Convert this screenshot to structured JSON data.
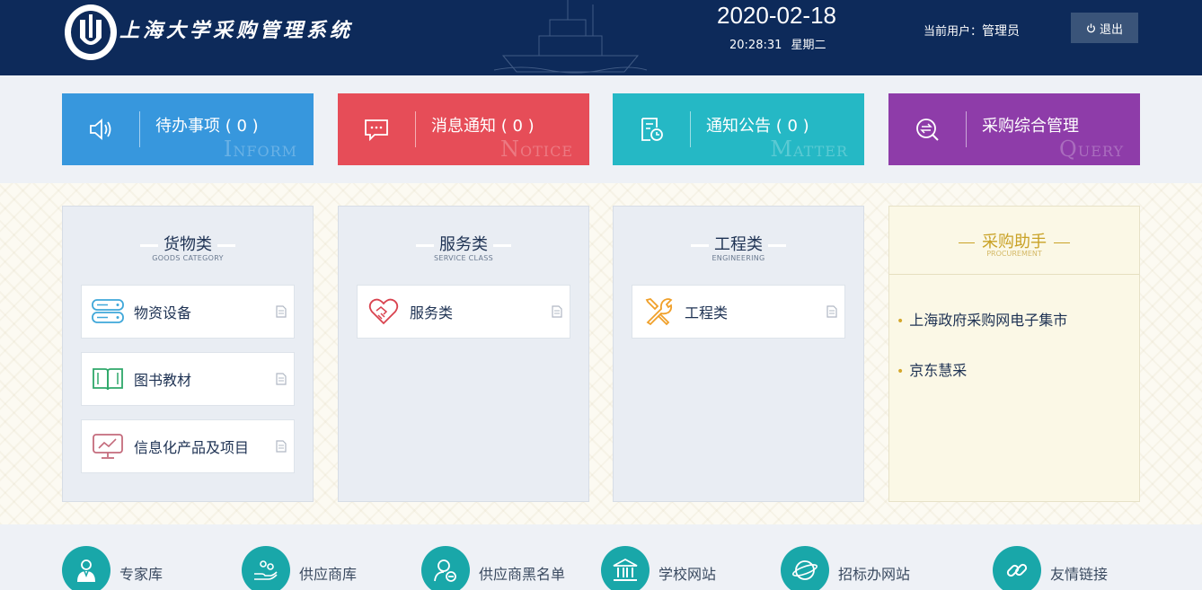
{
  "header": {
    "system_title": "上海大学采购管理系统",
    "date": "2020-02-18",
    "time": "20:28:31",
    "weekday": "星期二",
    "user_label": "当前用户：",
    "user_name": "管理员",
    "logout_label": "退出"
  },
  "tiles": [
    {
      "label": "待办事项 ( 0 )",
      "ghost_first": "I",
      "ghost_rest": "NFORM",
      "color": "#3797dd",
      "icon": "speaker-icon"
    },
    {
      "label": "消息通知 ( 0 )",
      "ghost_first": "N",
      "ghost_rest": "OTICE",
      "color": "#e64d58",
      "icon": "chat-icon"
    },
    {
      "label": "通知公告 ( 0 )",
      "ghost_first": "M",
      "ghost_rest": "ATTER",
      "color": "#25b8c5",
      "icon": "document-clock-icon"
    },
    {
      "label": "采购综合管理",
      "ghost_first": "Q",
      "ghost_rest": "UERY",
      "color": "#8e3ca9",
      "icon": "search-exchange-icon"
    }
  ],
  "categories": [
    {
      "title": "货物类",
      "subtitle": "GOODS CATEGORY",
      "items": [
        "物资设备",
        "图书教材",
        "信息化产品及项目"
      ]
    },
    {
      "title": "服务类",
      "subtitle": "SERVICE CLASS",
      "items": [
        "服务类"
      ]
    },
    {
      "title": "工程类",
      "subtitle": "ENGINEERING",
      "items": [
        "工程类"
      ]
    }
  ],
  "helper": {
    "title": "采购助手",
    "subtitle": "PROCUREMENT",
    "links": [
      "上海政府采购网电子集市",
      "京东慧采"
    ]
  },
  "quick_links": [
    "专家库",
    "供应商库",
    "供应商黑名单",
    "学校网站",
    "招标办网站",
    "友情链接"
  ]
}
